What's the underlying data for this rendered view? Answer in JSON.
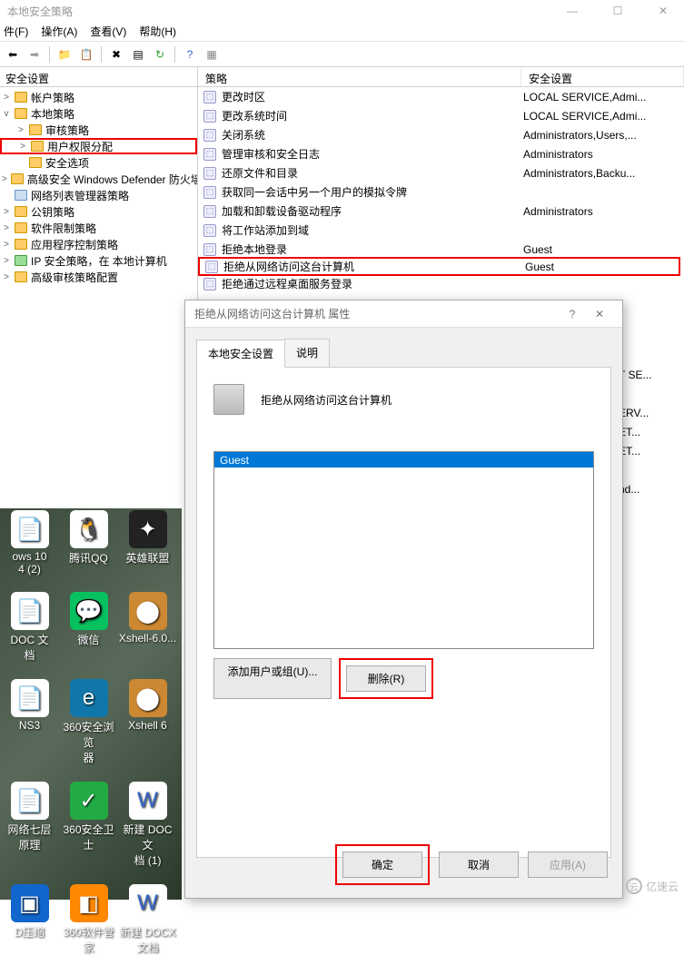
{
  "window": {
    "title": "本地安全策略",
    "min": "—",
    "max": "☐",
    "close": "✕"
  },
  "menu": {
    "file": "件(F)",
    "action": "操作(A)",
    "view": "查看(V)",
    "help": "帮助(H)"
  },
  "tree": {
    "header": "安全设置",
    "items": [
      {
        "l": 1,
        "t": ">",
        "icon": "folder",
        "label": "帐户策略"
      },
      {
        "l": 1,
        "t": "v",
        "icon": "folder",
        "label": "本地策略"
      },
      {
        "l": 2,
        "t": ">",
        "icon": "folder",
        "label": "审核策略"
      },
      {
        "l": 2,
        "t": ">",
        "icon": "folder",
        "label": "用户权限分配",
        "hl": true
      },
      {
        "l": 2,
        "t": "",
        "icon": "folder",
        "label": "安全选项"
      },
      {
        "l": 1,
        "t": ">",
        "icon": "folder",
        "label": "高级安全 Windows Defender 防火墙"
      },
      {
        "l": 1,
        "t": "",
        "icon": "folder-blue",
        "label": "网络列表管理器策略"
      },
      {
        "l": 1,
        "t": ">",
        "icon": "folder",
        "label": "公钥策略"
      },
      {
        "l": 1,
        "t": ">",
        "icon": "folder",
        "label": "软件限制策略"
      },
      {
        "l": 1,
        "t": ">",
        "icon": "folder",
        "label": "应用程序控制策略"
      },
      {
        "l": 1,
        "t": ">",
        "icon": "folder-green",
        "label": "IP 安全策略，在 本地计算机"
      },
      {
        "l": 1,
        "t": ">",
        "icon": "folder",
        "label": "高级审核策略配置"
      }
    ]
  },
  "list": {
    "col1": "策略",
    "col2": "安全设置",
    "rows": [
      {
        "name": "更改时区",
        "val": "LOCAL SERVICE,Admi..."
      },
      {
        "name": "更改系统时间",
        "val": "LOCAL SERVICE,Admi..."
      },
      {
        "name": "关闭系统",
        "val": "Administrators,Users,..."
      },
      {
        "name": "管理审核和安全日志",
        "val": "Administrators"
      },
      {
        "name": "还原文件和目录",
        "val": "Administrators,Backu..."
      },
      {
        "name": "获取同一会话中另一个用户的模拟令牌",
        "val": ""
      },
      {
        "name": "加载和卸载设备驱动程序",
        "val": "Administrators"
      },
      {
        "name": "将工作站添加到域",
        "val": ""
      },
      {
        "name": "拒绝本地登录",
        "val": "Guest"
      },
      {
        "name": "拒绝从网络访问这台计算机",
        "val": "Guest",
        "hl": true
      },
      {
        "name": "拒绝通过远程桌面服务登录",
        "val": ""
      }
    ]
  },
  "underList": [
    "",
    "",
    "",
    "T SE...",
    "",
    "ERV...",
    "ET...",
    "ET...",
    "",
    "nd..."
  ],
  "dialog": {
    "title": "拒绝从网络访问这台计算机 属性",
    "help": "?",
    "close": "✕",
    "tab1": "本地安全设置",
    "tab2": "说明",
    "policyName": "拒绝从网络访问这台计算机",
    "user": "Guest",
    "addBtn": "添加用户或组(U)...",
    "removeBtn": "删除(R)",
    "okBtn": "确定",
    "cancelBtn": "取消",
    "applyBtn": "应用(A)"
  },
  "desktop": [
    {
      "label": "ows 10\n4 (2)",
      "bg": "#fff",
      "glyph": "📄"
    },
    {
      "label": "腾讯QQ",
      "bg": "#fff",
      "glyph": "🐧"
    },
    {
      "label": "英雄联盟",
      "bg": "#222",
      "glyph": "✦"
    },
    {
      "label": "DOC 文\n档",
      "bg": "#fff",
      "glyph": "📄"
    },
    {
      "label": "微信",
      "bg": "#07c160",
      "glyph": "💬"
    },
    {
      "label": "Xshell-6.0...",
      "bg": "#c83",
      "glyph": "⬤"
    },
    {
      "label": "NS3",
      "bg": "#fff",
      "glyph": "📄"
    },
    {
      "label": "360安全浏览\n器",
      "bg": "#17a",
      "glyph": "e"
    },
    {
      "label": "Xshell 6",
      "bg": "#c83",
      "glyph": "⬤"
    },
    {
      "label": "网络七层\n原理",
      "bg": "#fff",
      "glyph": "📄"
    },
    {
      "label": "360安全卫士",
      "bg": "#2a4",
      "glyph": "✓"
    },
    {
      "label": "新建 DOC 文\n档 (1)",
      "bg": "#fff",
      "glyph": "W"
    },
    {
      "label": "D压缩",
      "bg": "#16c",
      "glyph": "▣"
    },
    {
      "label": "360软件管家",
      "bg": "#f80",
      "glyph": "◧"
    },
    {
      "label": "新建 DOCX\n文档",
      "bg": "#fff",
      "glyph": "W"
    }
  ],
  "watermark": "亿速云"
}
